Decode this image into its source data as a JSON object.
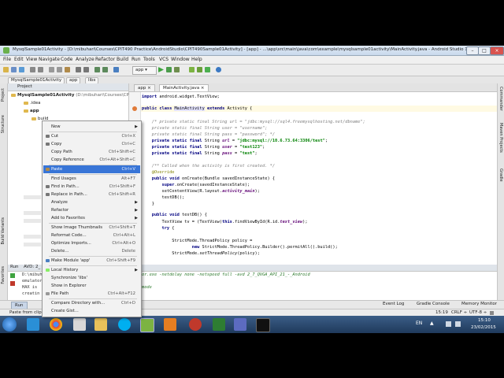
{
  "window": {
    "title": "MysqlSample01Activity - [D:\\mibuhari\\Courses\\CPIT490 Practice\\AndroidStudio\\CPIT490Sample01Activity] - [app] - ...\\app\\src\\main\\java\\com\\example\\mysqlsample01activity\\MainActivity.java - Android Studio 1.0.1"
  },
  "menubar": [
    "File",
    "Edit",
    "View",
    "Navigate",
    "Code",
    "Analyze",
    "Refactor",
    "Build",
    "Run",
    "Tools",
    "VCS",
    "Window",
    "Help"
  ],
  "breadcrumbs": [
    "MysqlSample01Activity",
    "app",
    "libs"
  ],
  "project": {
    "header": "Project",
    "root": "MysqlSample01Activity",
    "root_path": "(D:\\mibuhari\\Courses\\CPIT",
    "items": [
      ".idea",
      "app",
      "build"
    ]
  },
  "editor": {
    "tabs": [
      "app",
      "MainActivity.java"
    ],
    "lines": [
      "import android.widget.TextView;",
      "",
      "public class MainActivity extends Activity {",
      "",
      "    /* private static final String url = \"jdbc:mysql://sql4.freemysqlhosting.net/dbname\";",
      "    private static final String user = \"username\";",
      "    private static final String pass = \"password\"; */",
      "    private static final String url = \"jdbc:mysql://10.6.73.64:3306/test\";",
      "    private static final String user = \"test123\";",
      "    private static final String pass = \"test\";",
      "",
      "    /** Called when the activity is first created. */",
      "    @Override",
      "    public void onCreate(Bundle savedInstanceState) {",
      "        super.onCreate(savedInstanceState);",
      "        setContentView(R.layout.activity_main);",
      "        testDB();",
      "    }",
      "",
      "    public void testDB() {",
      "        TextView tv = (TextView)this.findViewById(R.id.text_view);",
      "        try {",
      "",
      "            StrictMode.ThreadPolicy policy =",
      "                    new StrictMode.ThreadPolicy.Builder().permitAll().build();",
      "            StrictMode.setThreadPolicy(policy);"
    ]
  },
  "run": {
    "header_label": "Run",
    "config": "AVD: 2_",
    "console_lines": [
      "D:\\mibuh",
      "emulator",
      "HAX is",
      "creatin"
    ],
    "command": "or.exe -netdelay none -netspeed full -avd 2_7_QVGA_API_21_-_Android",
    "mode_line": "mode"
  },
  "context_menu": {
    "items": [
      {
        "label": "New",
        "shortcut": "",
        "submenu": true
      },
      {
        "label": "Cut",
        "shortcut": "Ctrl+X"
      },
      {
        "label": "Copy",
        "shortcut": "Ctrl+C"
      },
      {
        "label": "Copy Path",
        "shortcut": "Ctrl+Shift+C"
      },
      {
        "label": "Copy Reference",
        "shortcut": "Ctrl+Alt+Shift+C"
      },
      {
        "label": "Paste",
        "shortcut": "Ctrl+V",
        "selected": true
      },
      {
        "label": "Find Usages",
        "shortcut": "Alt+F7"
      },
      {
        "label": "Find in Path...",
        "shortcut": "Ctrl+Shift+F"
      },
      {
        "label": "Replace in Path...",
        "shortcut": "Ctrl+Shift+R"
      },
      {
        "label": "Analyze",
        "shortcut": "",
        "submenu": true
      },
      {
        "label": "Refactor",
        "shortcut": "",
        "submenu": true
      },
      {
        "label": "Add to Favorites",
        "shortcut": "",
        "submenu": true
      },
      {
        "label": "Show Image Thumbnails",
        "shortcut": "Ctrl+Shift+T"
      },
      {
        "label": "Reformat Code...",
        "shortcut": "Ctrl+Alt+L"
      },
      {
        "label": "Optimize Imports...",
        "shortcut": "Ctrl+Alt+O"
      },
      {
        "label": "Delete...",
        "shortcut": "Delete"
      },
      {
        "label": "Make Module 'app'",
        "shortcut": "Ctrl+Shift+F9"
      },
      {
        "label": "Local History",
        "shortcut": "",
        "submenu": true
      },
      {
        "label": "Synchronize 'libs'",
        "shortcut": ""
      },
      {
        "label": "Show in Explorer",
        "shortcut": ""
      },
      {
        "label": "File Path",
        "shortcut": "Ctrl+Alt+F12"
      },
      {
        "label": "Compare Directory with...",
        "shortcut": "Ctrl+D"
      },
      {
        "label": "Create Gist...",
        "shortcut": ""
      }
    ]
  },
  "bottom_tabs": {
    "run": "Run",
    "event_log": "Event Log",
    "gradle_console": "Gradle Console",
    "memory_monitor": "Memory Monitor"
  },
  "status": {
    "left": "Paste from clipb",
    "position": "15:19",
    "line_sep": "CRLF ÷",
    "encoding": "UTF-8 ÷"
  },
  "side_tabs": {
    "left": [
      "Project",
      "Structure",
      "Build Variants",
      "Favorites"
    ],
    "right": [
      "Commander",
      "Maven Projects",
      "Gradle"
    ]
  },
  "taskbar": {
    "language": "EN",
    "time": "15:10",
    "date": "23/02/2015"
  },
  "colors": {
    "selection": "#3875d7",
    "taskbar": "#1f3a5c",
    "keyword": "#000080",
    "string": "#008000",
    "comment": "#808080"
  }
}
